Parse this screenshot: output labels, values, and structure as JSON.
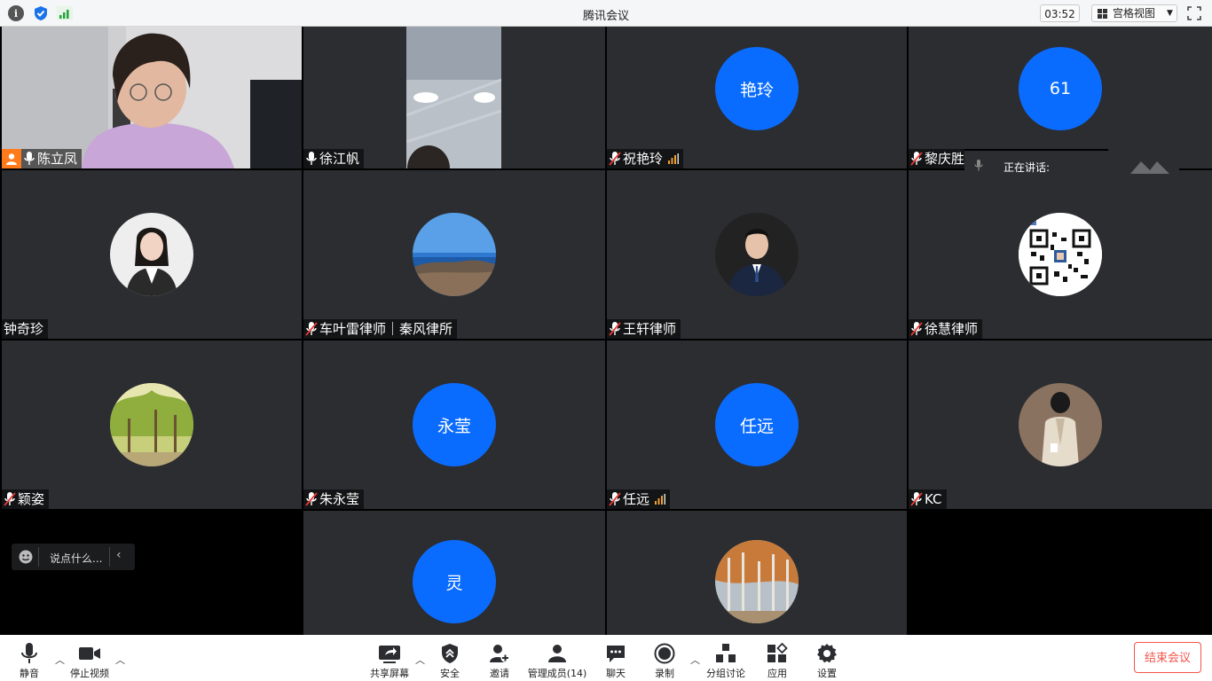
{
  "window": {
    "title": "腾讯会议",
    "timer": "03:52",
    "view_mode": "宫格视图"
  },
  "colors": {
    "accent": "#0a6cff",
    "tile_bg": "#2b2d31",
    "end_button": "#f2554c",
    "host_badge": "#ff7a1a"
  },
  "participants": [
    {
      "name": "陈立凤",
      "mic": "on",
      "video": true,
      "host": true
    },
    {
      "name": "徐江帆",
      "mic": "on",
      "video": true
    },
    {
      "name": "祝艳玲",
      "mic": "muted",
      "avatar_text": "艳玲",
      "signal": true
    },
    {
      "name": "黎庆胜",
      "mic": "muted",
      "avatar_text": "61"
    },
    {
      "name": "钟奇珍",
      "mic": "none",
      "avatar": "photo-woman"
    },
    {
      "name": "车叶雷律师｜秦风律所",
      "mic": "muted",
      "avatar": "photo-seaside"
    },
    {
      "name": "王轩律师",
      "mic": "muted",
      "avatar": "photo-man-suit"
    },
    {
      "name": "徐慧律师",
      "mic": "muted",
      "avatar": "qr-code"
    },
    {
      "name": "颖姿",
      "mic": "muted",
      "avatar": "photo-trees"
    },
    {
      "name": "朱永莹",
      "mic": "muted",
      "avatar_text": "永莹"
    },
    {
      "name": "任远",
      "mic": "muted",
      "avatar_text": "任远",
      "signal": true
    },
    {
      "name": "KC",
      "mic": "muted",
      "avatar": "photo-person"
    },
    {
      "name": "",
      "avatar_text": "灵"
    },
    {
      "name": "",
      "avatar": "photo-autumn-trees"
    }
  ],
  "speaking": {
    "label": "正在讲话:"
  },
  "chat": {
    "placeholder": "说点什么..."
  },
  "toolbar": {
    "mute": "静音",
    "stop_video": "停止视频",
    "share_screen": "共享屏幕",
    "security": "安全",
    "invite": "邀请",
    "manage_members": "管理成员(14)",
    "chat": "聊天",
    "record": "录制",
    "breakout": "分组讨论",
    "apps": "应用",
    "settings": "设置",
    "end_meeting": "结束会议"
  }
}
